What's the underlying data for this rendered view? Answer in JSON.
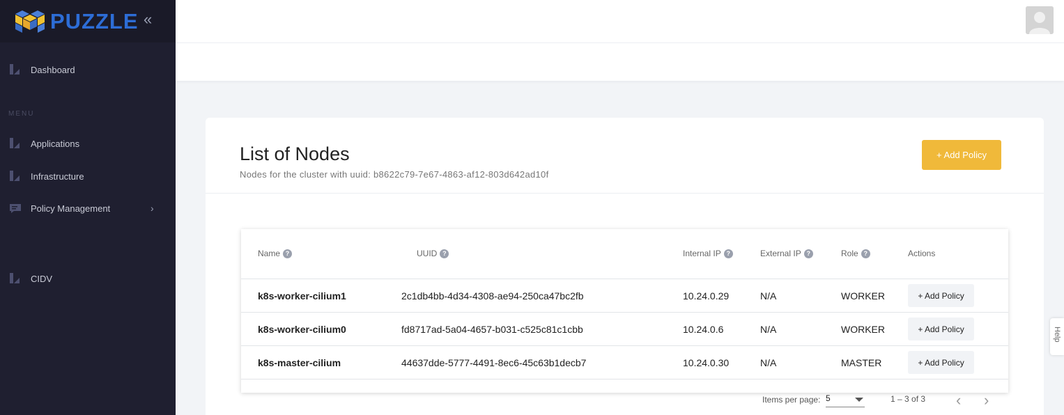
{
  "brand": {
    "name": "PUZZLE"
  },
  "sidebar": {
    "collapse_icon": "double-chevron-left",
    "menu_heading": "MENU",
    "items": [
      {
        "label": "Dashboard",
        "icon": "chart-icon"
      },
      {
        "label": "Applications",
        "icon": "chart-icon"
      },
      {
        "label": "Infrastructure",
        "icon": "chart-icon"
      },
      {
        "label": "Policy Management",
        "icon": "message-icon"
      },
      {
        "label": "CIDV",
        "icon": "chart-icon"
      }
    ]
  },
  "card": {
    "title": "List of Nodes",
    "subtitle": "Nodes for the cluster with uuid: b8622c79-7e67-4863-af12-803d642ad10f",
    "add_policy_label": "+ Add Policy"
  },
  "table": {
    "headers": {
      "name": "Name",
      "uuid": "UUID",
      "internal_ip": "Internal IP",
      "external_ip": "External IP",
      "role": "Role",
      "actions": "Actions"
    },
    "help_glyph": "?",
    "rows": [
      {
        "name": "k8s-worker-cilium1",
        "uuid": "2c1db4bb-4d34-4308-ae94-250ca47bc2fb",
        "internal_ip": "10.24.0.29",
        "external_ip": "N/A",
        "role": "WORKER",
        "action": "+ Add Policy"
      },
      {
        "name": "k8s-worker-cilium0",
        "uuid": "fd8717ad-5a04-4657-b031-c525c81c1cbb",
        "internal_ip": "10.24.0.6",
        "external_ip": "N/A",
        "role": "WORKER",
        "action": "+ Add Policy"
      },
      {
        "name": "k8s-master-cilium",
        "uuid": "44637dde-5777-4491-8ec6-45c63b1decb7",
        "internal_ip": "10.24.0.30",
        "external_ip": "N/A",
        "role": "MASTER",
        "action": "+ Add Policy"
      }
    ]
  },
  "paginator": {
    "items_per_page_label": "Items per page:",
    "items_per_page_value": "5",
    "range_label": "1 – 3 of 3"
  },
  "help_tab": {
    "label": "Help"
  },
  "colors": {
    "sidebar_bg": "#1f1f30",
    "brand_blue": "#2d6dd6",
    "accent": "#f0b93a"
  }
}
